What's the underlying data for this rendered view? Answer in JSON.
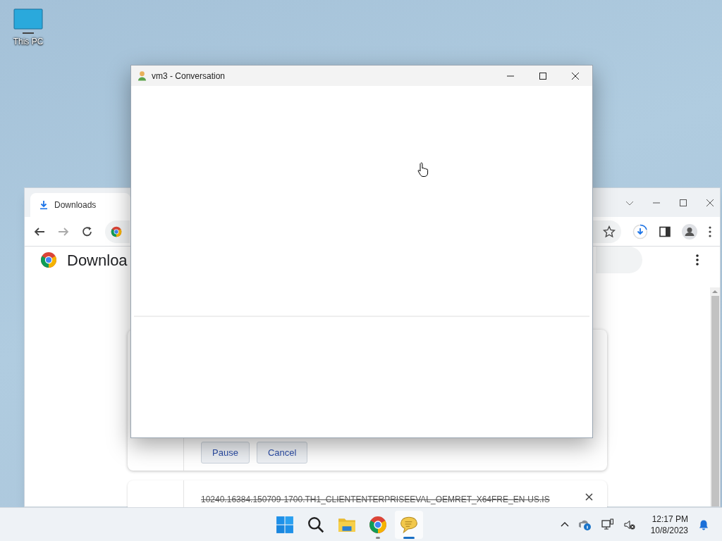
{
  "desktop": {
    "icons": [
      {
        "label": "This PC"
      }
    ]
  },
  "browser": {
    "tabs": [
      {
        "label": "Downloads",
        "selected": true
      }
    ],
    "page_title": "Downloa",
    "downloads": [
      {
        "buttons": [
          "Pause",
          "Cancel"
        ]
      },
      {
        "file_name": "10240.16384.150709-1700.TH1_CLIENTENTERPRISEEVAL_OEMRET_X64FRE_EN-US.IS",
        "cancelled": true
      }
    ]
  },
  "conversation_window": {
    "title": "vm3 - Conversation"
  },
  "taskbar": {
    "apps": [
      {
        "kind": "start",
        "running": false,
        "selected": false
      },
      {
        "kind": "search",
        "running": false,
        "selected": false
      },
      {
        "kind": "files",
        "running": false,
        "selected": false
      },
      {
        "kind": "browser",
        "running": true,
        "selected": false
      },
      {
        "kind": "chat",
        "running": true,
        "selected": true
      }
    ],
    "tray": {
      "time": "12:17 PM",
      "date": "10/8/2023"
    }
  }
}
